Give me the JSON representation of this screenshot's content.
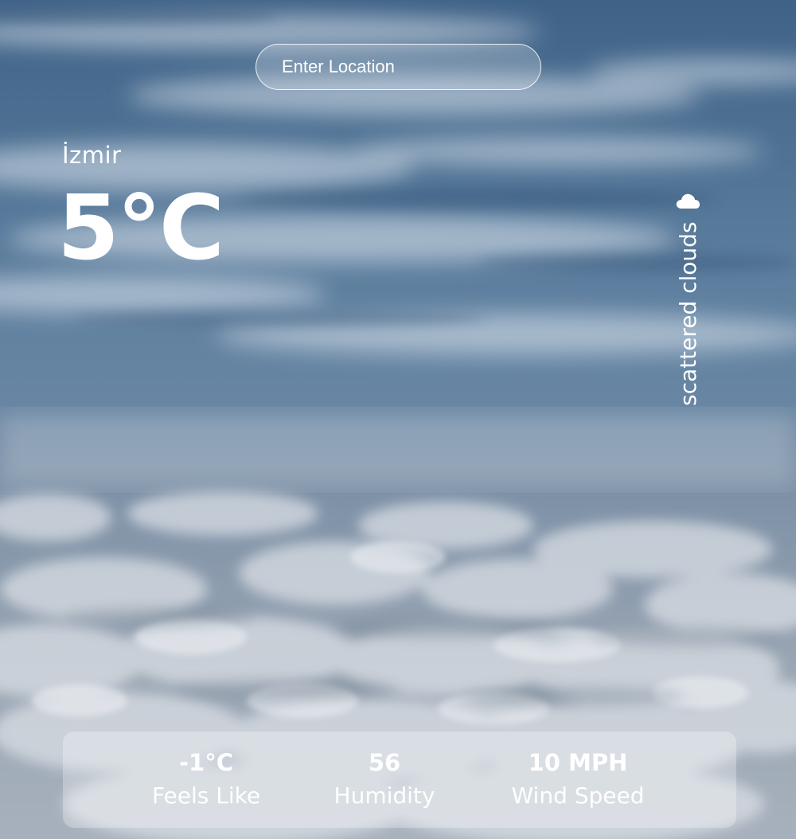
{
  "search": {
    "placeholder": "Enter Location",
    "value": ""
  },
  "weather": {
    "location": "İzmir",
    "temperature": "5°C",
    "description": "scattered clouds",
    "icon": "cloud-icon"
  },
  "stats": [
    {
      "value": "-1°C",
      "label": "Feels Like"
    },
    {
      "value": "56",
      "label": "Humidity"
    },
    {
      "value": "10 MPH",
      "label": "Wind Speed"
    }
  ],
  "colors": {
    "text": "#ffffff",
    "sky_top": "#3f6287",
    "sky_bottom": "#a7b1bd",
    "panel": "rgba(255,255,255,0.28)"
  }
}
